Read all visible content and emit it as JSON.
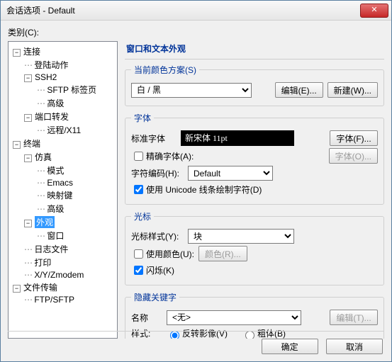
{
  "window": {
    "title": "会话选项 - Default",
    "close_glyph": "✕"
  },
  "category_label": "类别(C):",
  "tree": {
    "n0": "连接",
    "n0a": "登陆动作",
    "n0b": "SSH2",
    "n0b1": "SFTP 标签页",
    "n0b2": "高级",
    "n0c": "端口转发",
    "n0c1": "远程/X11",
    "n1": "终端",
    "n1a": "仿真",
    "n1a1": "模式",
    "n1a2": "Emacs",
    "n1a3": "映射键",
    "n1a4": "高级",
    "n1b": "外观",
    "n1b1": "窗口",
    "n1c": "日志文件",
    "n1d": "打印",
    "n1e": "X/Y/Zmodem",
    "n2": "文件传输",
    "n2a": "FTP/SFTP"
  },
  "section_title": "窗口和文本外观",
  "color": {
    "legend": "当前颜色方案(S)",
    "value": "白 / 黑",
    "edit": "编辑(E)...",
    "new": "新建(W)..."
  },
  "font": {
    "legend": "字体",
    "std_label": "标准字体",
    "display": "新宋体  11pt",
    "font_btn": "字体(F)...",
    "narrow_label": "精确字体(A):",
    "narrow_btn": "字体(O)...",
    "enc_label": "字符编码(H):",
    "enc_value": "Default",
    "unicode_label": "使用 Unicode 线条绘制字符(D)"
  },
  "cursor": {
    "legend": "光标",
    "style_label": "光标样式(Y):",
    "style_value": "块",
    "usecolor_label": "使用颜色(U):",
    "color_btn": "颜色(R)...",
    "blink_label": "闪烁(K)"
  },
  "hidden": {
    "legend": "隐藏关键字",
    "name_label": "名称",
    "name_value": "<无>",
    "edit_btn": "编辑(T)...",
    "style_label": "样式:",
    "opt1": "反转影像(V)",
    "opt2": "粗体(B)"
  },
  "footer": {
    "ok": "确定",
    "cancel": "取消"
  }
}
